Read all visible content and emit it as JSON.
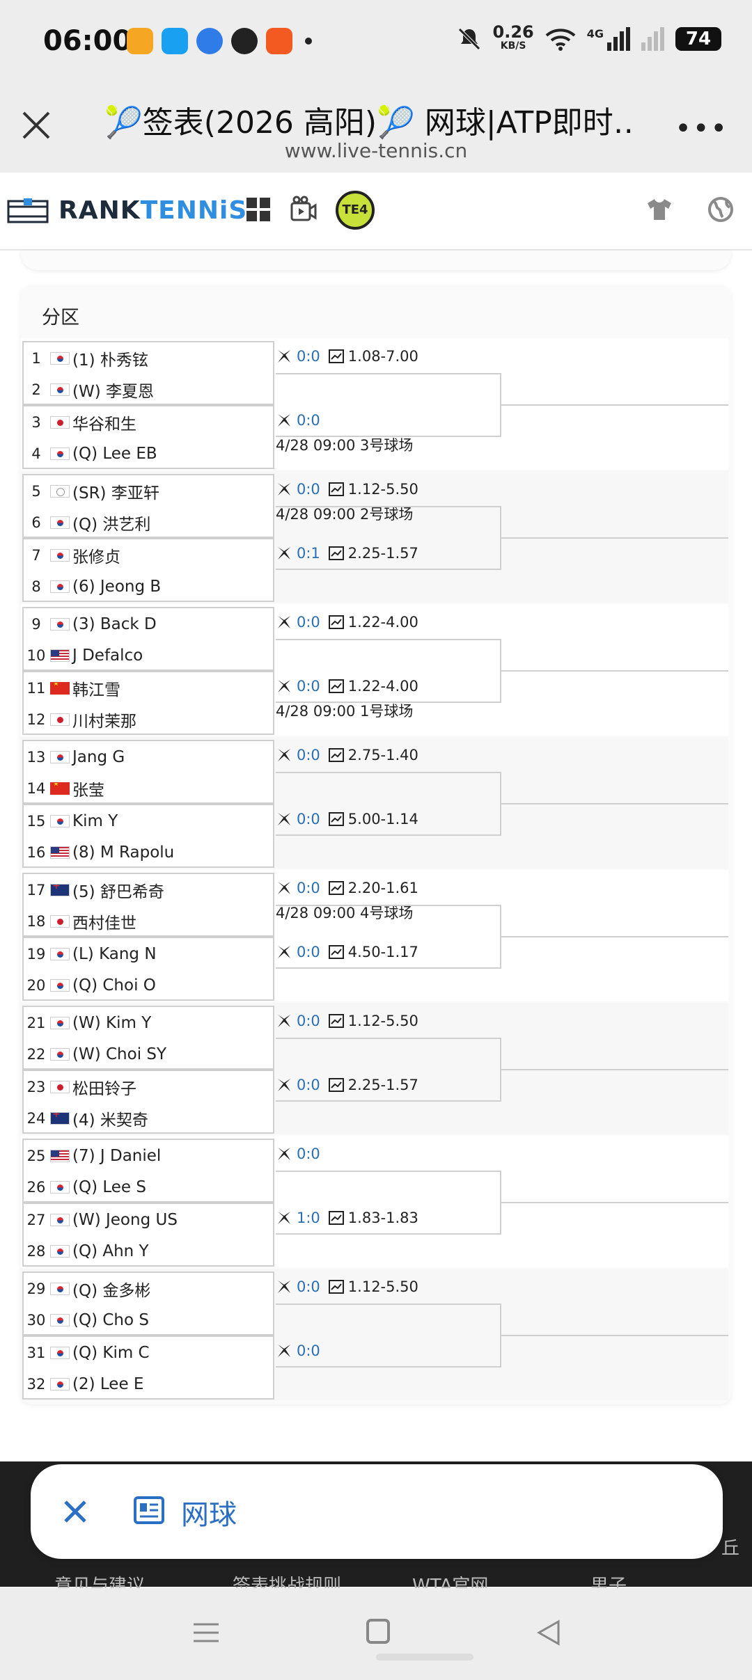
{
  "status_bar": {
    "time": "06:00",
    "net_speed": "0.26",
    "net_unit": "KB/S",
    "network": "4G",
    "battery": "74"
  },
  "browser": {
    "title": "🎾签表(2026 高阳)🎾 网球|ATP即时…",
    "url": "www.live-tennis.cn",
    "more": "•••"
  },
  "site_nav": {
    "logo_rank": "RANK",
    "logo_tennis": "TENNiS",
    "badge": "TE4"
  },
  "section": {
    "label": "分区"
  },
  "colors": {
    "score_blue": "#2a6fb5",
    "accent": "#2b6fc4"
  },
  "players": [
    {
      "num": "1",
      "flag": "kr",
      "name": "(1) 朴秀铉"
    },
    {
      "num": "2",
      "flag": "kr",
      "name": "(W) 李夏恩"
    },
    {
      "num": "3",
      "flag": "jp",
      "name": "华谷和生"
    },
    {
      "num": "4",
      "flag": "kr",
      "name": "(Q) Lee EB"
    },
    {
      "num": "5",
      "flag": "ne",
      "name": "(SR) 李亚轩"
    },
    {
      "num": "6",
      "flag": "kr",
      "name": "(Q) 洪艺利"
    },
    {
      "num": "7",
      "flag": "kr",
      "name": "张修贞"
    },
    {
      "num": "8",
      "flag": "kr",
      "name": "(6) Jeong B"
    },
    {
      "num": "9",
      "flag": "kr",
      "name": "(3) Back D"
    },
    {
      "num": "10",
      "flag": "us",
      "name": "J Defalco"
    },
    {
      "num": "11",
      "flag": "cn",
      "name": "韩江雪"
    },
    {
      "num": "12",
      "flag": "jp",
      "name": "川村茉那"
    },
    {
      "num": "13",
      "flag": "kr",
      "name": "Jang G"
    },
    {
      "num": "14",
      "flag": "cn",
      "name": "张莹"
    },
    {
      "num": "15",
      "flag": "kr",
      "name": "Kim Y"
    },
    {
      "num": "16",
      "flag": "us",
      "name": "(8) M Rapolu"
    },
    {
      "num": "17",
      "flag": "au",
      "name": "(5) 舒巴希奇"
    },
    {
      "num": "18",
      "flag": "jp",
      "name": "西村佳世"
    },
    {
      "num": "19",
      "flag": "kr",
      "name": "(L) Kang N"
    },
    {
      "num": "20",
      "flag": "kr",
      "name": "(Q) Choi O"
    },
    {
      "num": "21",
      "flag": "kr",
      "name": "(W) Kim Y"
    },
    {
      "num": "22",
      "flag": "kr",
      "name": "(W) Choi SY"
    },
    {
      "num": "23",
      "flag": "jp",
      "name": "松田铃子"
    },
    {
      "num": "24",
      "flag": "au",
      "name": "(4) 米契奇"
    },
    {
      "num": "25",
      "flag": "us",
      "name": "(7) J Daniel"
    },
    {
      "num": "26",
      "flag": "kr",
      "name": "(Q) Lee S"
    },
    {
      "num": "27",
      "flag": "kr",
      "name": "(W) Jeong US"
    },
    {
      "num": "28",
      "flag": "kr",
      "name": "(Q) Ahn Y"
    },
    {
      "num": "29",
      "flag": "kr",
      "name": "(Q) 金多彬"
    },
    {
      "num": "30",
      "flag": "kr",
      "name": "(Q) Cho S"
    },
    {
      "num": "31",
      "flag": "kr",
      "name": "(Q) Kim C"
    },
    {
      "num": "32",
      "flag": "kr",
      "name": "(2) Lee E"
    }
  ],
  "matches": [
    {
      "score": "0:0",
      "odds": "1.08-7.00",
      "sched": ""
    },
    {
      "score": "0:0",
      "odds": "",
      "sched": "4/28 09:00 3号球场"
    },
    {
      "score": "0:0",
      "odds": "1.12-5.50",
      "sched": "4/28 09:00 2号球场"
    },
    {
      "score": "0:1",
      "odds": "2.25-1.57",
      "sched": ""
    },
    {
      "score": "0:0",
      "odds": "1.22-4.00",
      "sched": ""
    },
    {
      "score": "0:0",
      "odds": "1.22-4.00",
      "sched": "4/28 09:00 1号球场"
    },
    {
      "score": "0:0",
      "odds": "2.75-1.40",
      "sched": ""
    },
    {
      "score": "0:0",
      "odds": "5.00-1.14",
      "sched": ""
    },
    {
      "score": "0:0",
      "odds": "2.20-1.61",
      "sched": "4/28 09:00 4号球场"
    },
    {
      "score": "0:0",
      "odds": "4.50-1.17",
      "sched": ""
    },
    {
      "score": "0:0",
      "odds": "1.12-5.50",
      "sched": ""
    },
    {
      "score": "0:0",
      "odds": "2.25-1.57",
      "sched": ""
    },
    {
      "score": "0:0",
      "odds": "",
      "sched": ""
    },
    {
      "score": "1:0",
      "odds": "1.83-1.83",
      "sched": ""
    },
    {
      "score": "0:0",
      "odds": "1.12-5.50",
      "sched": ""
    },
    {
      "score": "0:0",
      "odds": "",
      "sched": ""
    }
  ],
  "bottom_sheet": {
    "label": "网球",
    "side_char": "丘"
  },
  "footer_links": [
    "意见与建议",
    "签表挑战规则",
    "WTA官网",
    "男子"
  ]
}
